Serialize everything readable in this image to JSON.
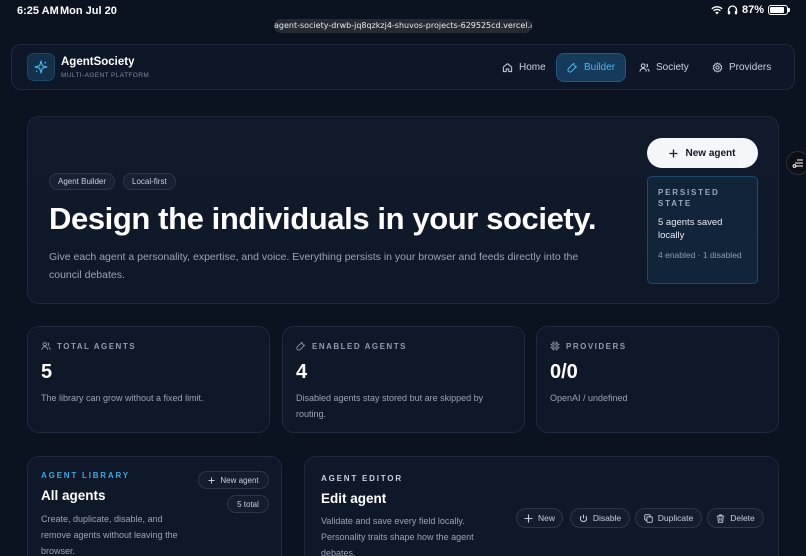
{
  "status_bar": {
    "time": "6:25 AM",
    "date": "Mon Jul 20",
    "battery": "87%",
    "url": "agent-society-drwb-jq8qzkzj4-shuvos-projects-629525cd.vercel.app"
  },
  "nav": {
    "brand": "AgentSociety",
    "brand_sub": "MULTI-AGENT PLATFORM",
    "items": [
      {
        "label": "Home",
        "icon": "home-icon"
      },
      {
        "label": "Builder",
        "icon": "wrench-icon",
        "active": true
      },
      {
        "label": "Society",
        "icon": "users-icon"
      },
      {
        "label": "Providers",
        "icon": "gear-icon"
      }
    ]
  },
  "hero": {
    "chips": [
      "Agent Builder",
      "Local-first"
    ],
    "title": "Design the individuals in your society.",
    "description": "Give each agent a personality, expertise, and voice. Everything persists in your browser and feeds directly into the council debates.",
    "new_agent_label": "New agent",
    "persisted": {
      "label": "PERSISTED STATE",
      "saved": "5 agents saved locally",
      "sub": "4 enabled · 1 disabled"
    }
  },
  "stats": [
    {
      "label": "TOTAL AGENTS",
      "value": "5",
      "desc": "The library can grow without a fixed limit.",
      "icon": "users-icon"
    },
    {
      "label": "ENABLED AGENTS",
      "value": "4",
      "desc": "Disabled agents stay stored but are skipped by routing.",
      "icon": "wrench-icon"
    },
    {
      "label": "PROVIDERS",
      "value": "0/0",
      "desc": "OpenAI / undefined",
      "icon": "cpu-icon"
    }
  ],
  "library": {
    "label": "AGENT LIBRARY",
    "title": "All agents",
    "description": "Create, duplicate, disable, and remove agents without leaving the browser.",
    "new_agent_label": "New agent",
    "total": "5 total"
  },
  "editor": {
    "label": "AGENT EDITOR",
    "title": "Edit agent",
    "description": "Validate and save every field locally. Personality traits shape how the agent debates.",
    "buttons": {
      "new": "New",
      "disable": "Disable",
      "duplicate": "Duplicate",
      "delete": "Delete"
    }
  },
  "colors": {
    "accent": "#3aa7e6",
    "background": "#0b1220",
    "card": "#0f1828"
  }
}
